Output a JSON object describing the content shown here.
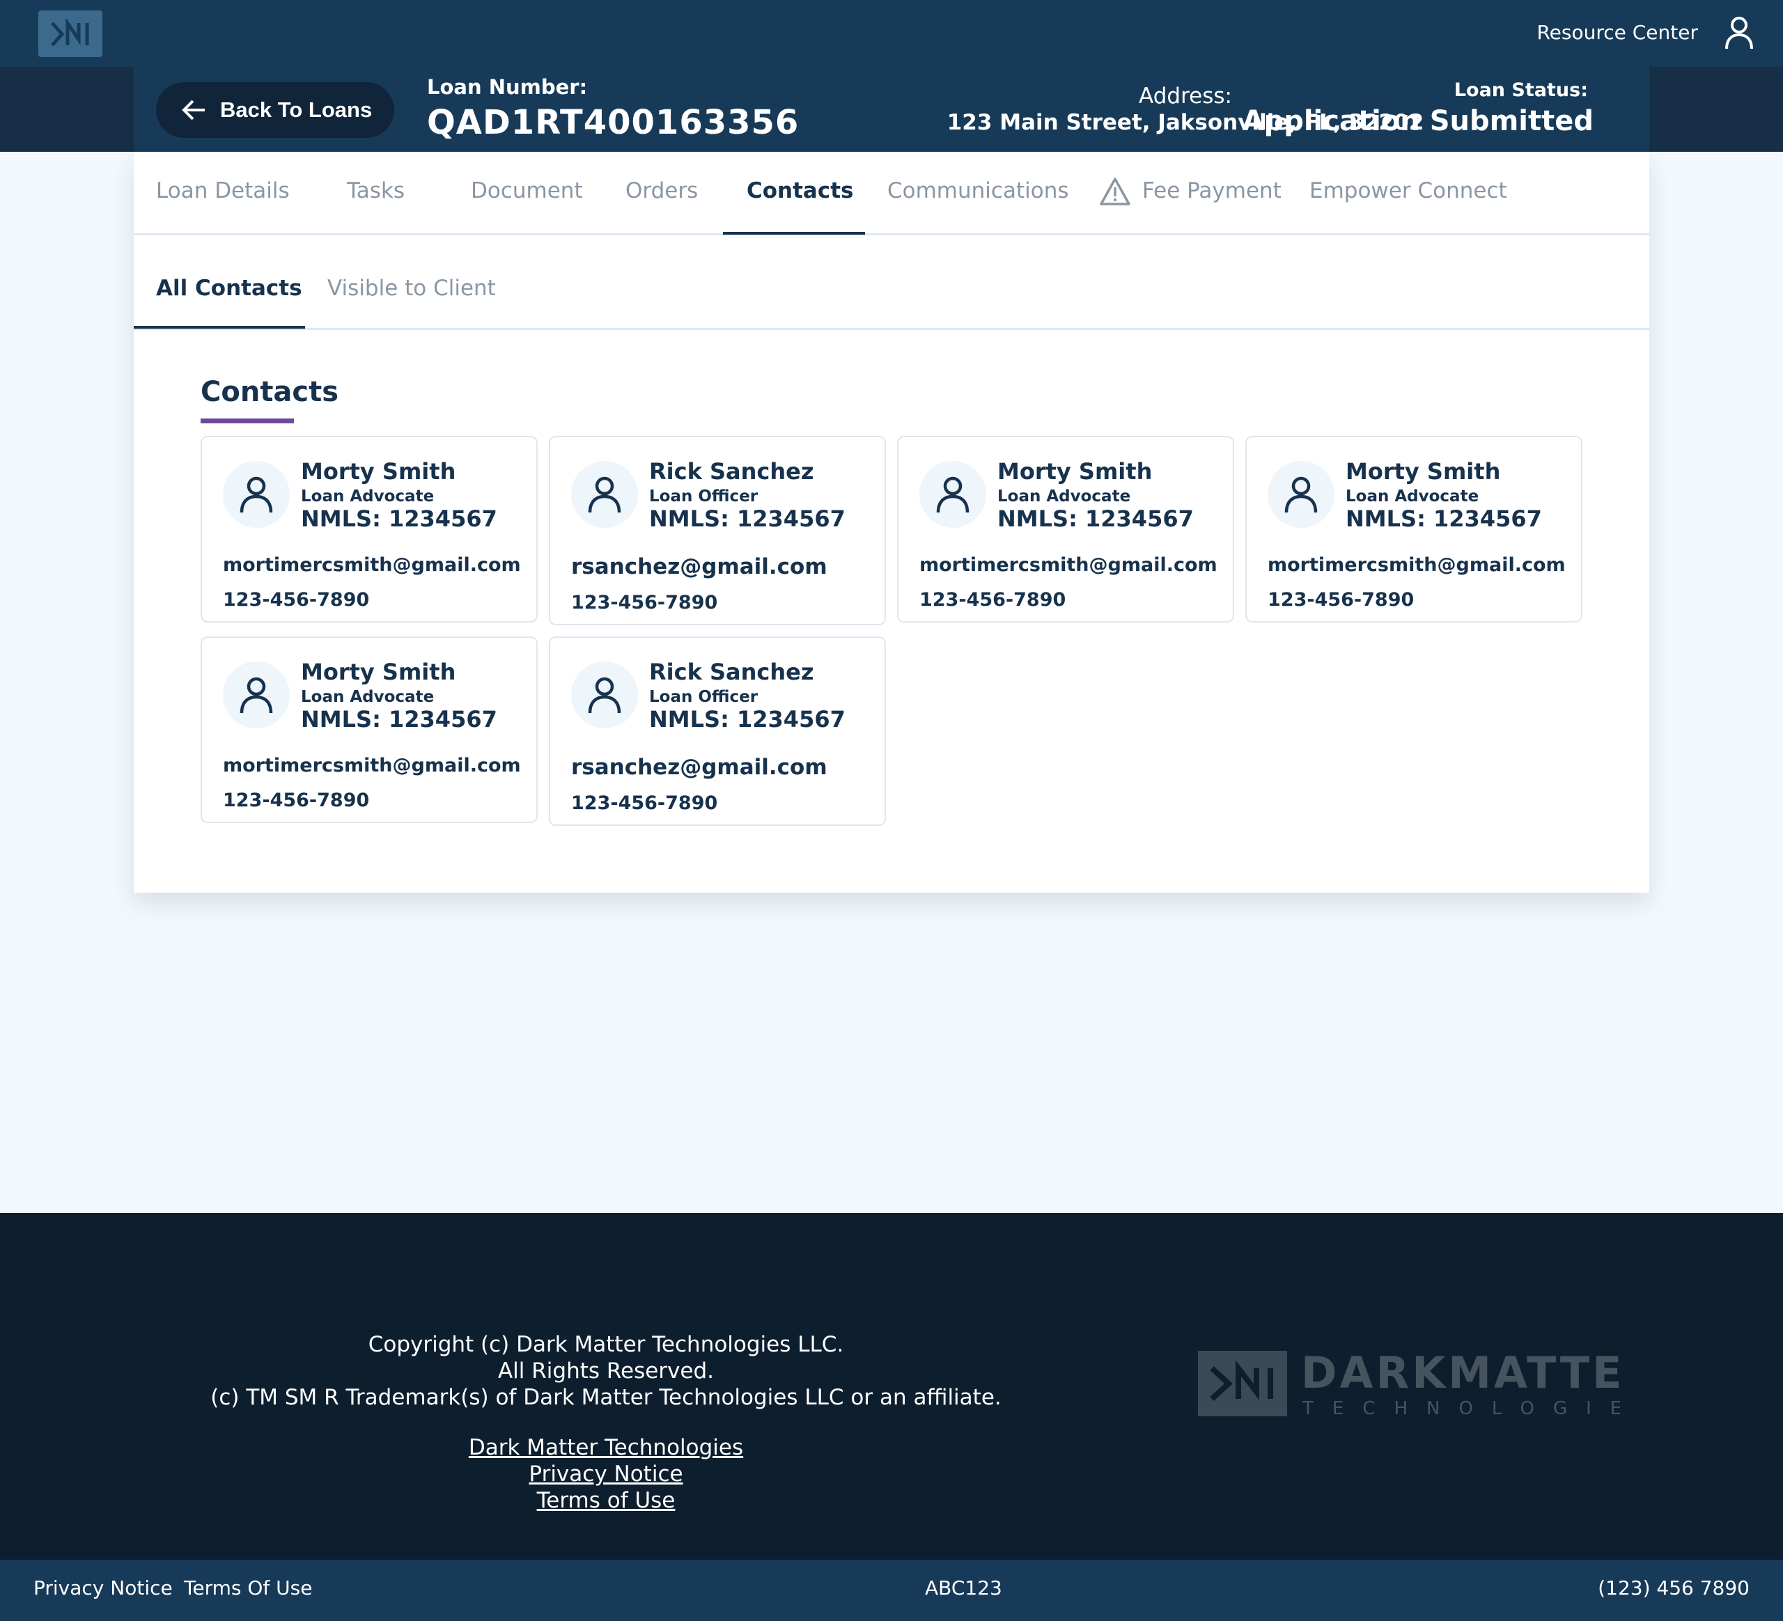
{
  "header": {
    "resource_center": "Resource Center",
    "logo_icon": "dm-logo-icon",
    "user_icon": "user-icon"
  },
  "loan": {
    "back_label": "Back To Loans",
    "number_label": "Loan Number:",
    "number": "QAD1RT400163356",
    "address_label": "Address:",
    "address": "123 Main Street, Jaksonville, FL, 32202",
    "status_label": "Loan Status:",
    "status": "Application Submitted"
  },
  "tabs": [
    {
      "label": "Loan Details"
    },
    {
      "label": "Tasks"
    },
    {
      "label": "Document"
    },
    {
      "label": "Orders"
    },
    {
      "label": "Contacts",
      "active": true
    },
    {
      "label": "Communications"
    },
    {
      "label": "Fee Payment",
      "icon": "warning-icon"
    },
    {
      "label": "Empower Connect"
    }
  ],
  "subtabs": [
    {
      "label": "All Contacts",
      "active": true
    },
    {
      "label": "Visible to Client"
    }
  ],
  "section_title": "Contacts",
  "contacts": [
    {
      "name": "Morty Smith",
      "role": "Loan Advocate",
      "nmls": "NMLS: 1234567",
      "email": "mortimercsmith@gmail.com",
      "phone": "123-456-7890"
    },
    {
      "name": "Rick Sanchez",
      "role": "Loan Officer",
      "nmls": "NMLS: 1234567",
      "email": "rsanchez@gmail.com",
      "phone": "123-456-7890"
    },
    {
      "name": "Morty Smith",
      "role": "Loan Advocate",
      "nmls": "NMLS: 1234567",
      "email": "mortimercsmith@gmail.com",
      "phone": "123-456-7890"
    },
    {
      "name": "Morty Smith",
      "role": "Loan Advocate",
      "nmls": "NMLS: 1234567",
      "email": "mortimercsmith@gmail.com",
      "phone": "123-456-7890"
    },
    {
      "name": "Morty Smith",
      "role": "Loan Advocate",
      "nmls": "NMLS: 1234567",
      "email": "mortimercsmith@gmail.com",
      "phone": "123-456-7890"
    },
    {
      "name": "Rick Sanchez",
      "role": "Loan Officer",
      "nmls": "NMLS: 1234567",
      "email": "rsanchez@gmail.com",
      "phone": "123-456-7890"
    }
  ],
  "footer": {
    "copyright_1": "Copyright (c) Dark Matter Technologies LLC.",
    "copyright_2": "All Rights Reserved.",
    "copyright_3": "(c) TM SM R Trademark(s) of Dark Matter Technologies LLC or an affiliate.",
    "link_company": "Dark Matter Technologies",
    "link_privacy": "Privacy Notice",
    "link_terms": "Terms of Use",
    "brand_word": "DARKMATTER",
    "brand_sub": "TECHNOLOGIES"
  },
  "bottom_bar": {
    "privacy": "Privacy Notice",
    "terms": "Terms Of Use",
    "code": "ABC123",
    "phone": "(123) 456 7890"
  },
  "colors": {
    "navy": "#173a58",
    "dark_navy": "#0d1f2e",
    "accent_purple": "#6b4a9b",
    "text_primary": "#17324d"
  }
}
